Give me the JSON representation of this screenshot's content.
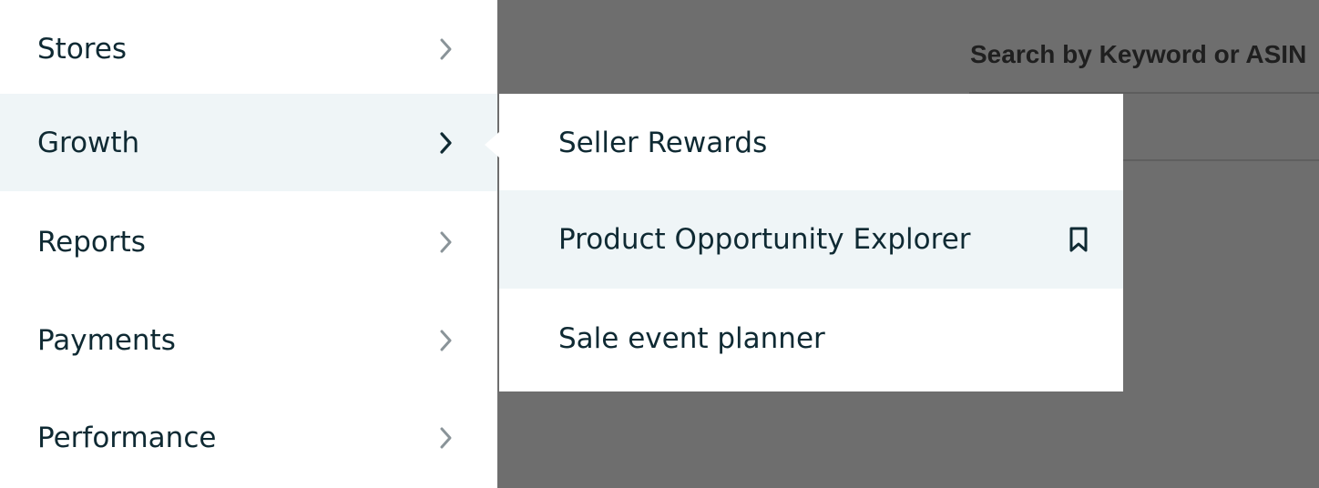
{
  "background": {
    "search_label": "Search by Keyword or ASIN"
  },
  "side_menu": {
    "items": [
      {
        "label": "Stores"
      },
      {
        "label": "Growth"
      },
      {
        "label": "Reports"
      },
      {
        "label": "Payments"
      },
      {
        "label": "Performance"
      }
    ],
    "active_item": "Growth"
  },
  "submenu": {
    "items": [
      {
        "label": "Seller Rewards"
      },
      {
        "label": "Product Opportunity Explorer",
        "icon": "bookmark-icon"
      },
      {
        "label": "Sale event planner"
      }
    ],
    "hovered_item": "Product Opportunity Explorer"
  },
  "colors": {
    "overlay": "#6f6f6f",
    "menu_bg": "#ffffff",
    "active_bg": "#eff5f7",
    "text": "#0f2a33",
    "chevron": "#8a9499",
    "chevron_active": "#0f2a33"
  }
}
